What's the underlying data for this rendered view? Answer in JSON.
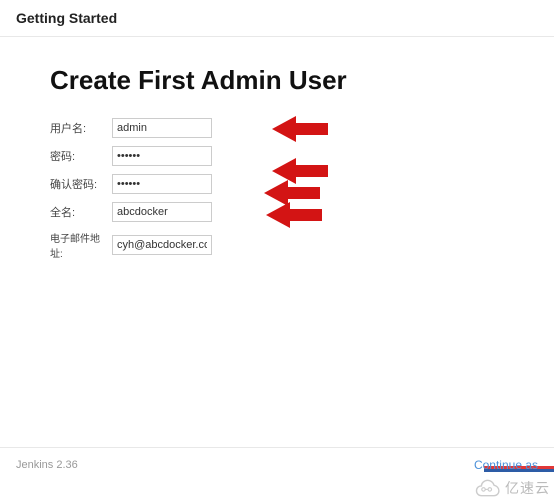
{
  "header": {
    "title": "Getting Started"
  },
  "main": {
    "heading": "Create First Admin User",
    "fields": {
      "username": {
        "label": "用户名:",
        "value": "admin"
      },
      "password": {
        "label": "密码:",
        "value": "••••••"
      },
      "confirm": {
        "label": "确认密码:",
        "value": "••••••"
      },
      "fullname": {
        "label": "全名:",
        "value": "abcdocker"
      },
      "email": {
        "label": "电子邮件地址:",
        "value": "cyh@abcdocker.com"
      }
    }
  },
  "footer": {
    "version": "Jenkins 2.36",
    "continue": "Continue as"
  },
  "watermark": {
    "text": "亿速云"
  }
}
